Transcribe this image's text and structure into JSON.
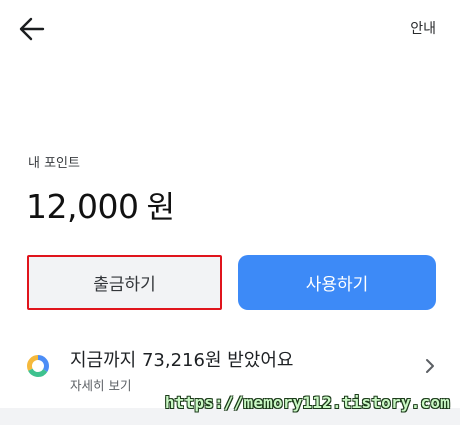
{
  "header": {
    "back_icon": "arrow-left-icon",
    "guide_label": "안내"
  },
  "points": {
    "label": "내 포인트",
    "amount": "12,000",
    "unit": "원"
  },
  "actions": {
    "withdraw_label": "출금하기",
    "use_label": "사용하기",
    "use_color": "#3d8af7",
    "highlight_border_color": "#e0141c"
  },
  "summary": {
    "title": "지금까지 73,216원 받았어요",
    "subtitle": "자세히 보기",
    "icon": "donut-chart-icon"
  },
  "watermark": {
    "text": "https://memory112.tistory.com"
  }
}
